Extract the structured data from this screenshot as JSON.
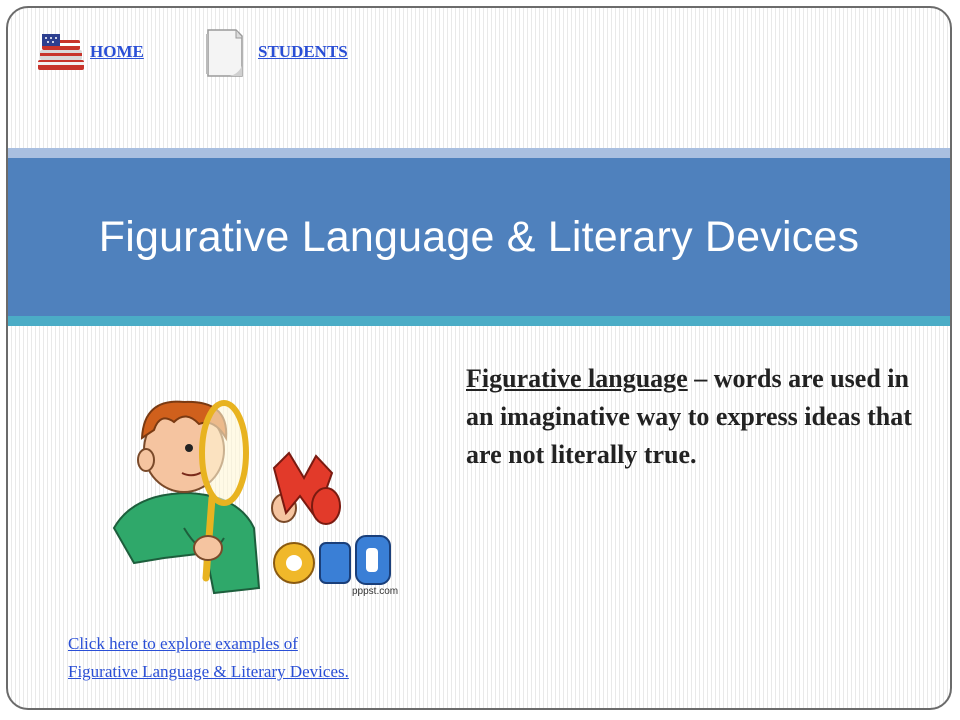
{
  "nav": {
    "home_label": "HOME",
    "students_label": "STUDENTS",
    "home_icon": "books-flag-icon",
    "students_icon": "document-icon"
  },
  "banner": {
    "title": "Figurative Language & Literary Devices",
    "colors": {
      "main": "#4f81bd",
      "top_strip": "#a9bfe0",
      "bottom_strip": "#4bacc6"
    }
  },
  "content": {
    "definition_term": "Figurative language",
    "definition_rest": " – words are used in an imaginative way to express ideas that are not literally true.",
    "clipart": "boy-with-magnifying-glass-word-illustration",
    "clipart_word": "WORD",
    "watermark": "pppst.com",
    "link_line1": "Click here to explore examples of",
    "link_line2": "Figurative Language & Literary Devices."
  }
}
